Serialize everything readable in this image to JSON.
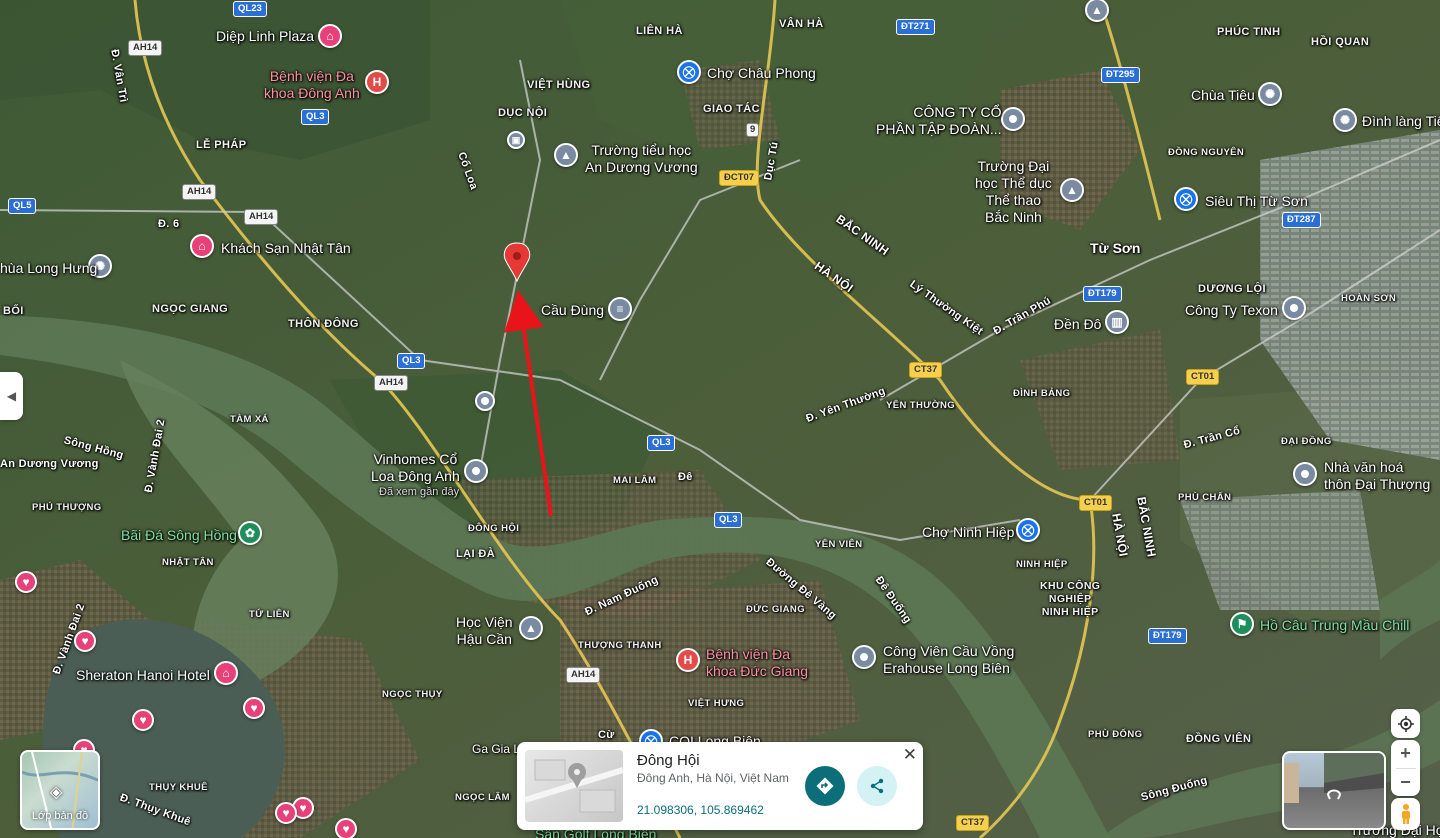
{
  "map": {
    "area_labels": [
      {
        "id": "van-ha",
        "text": "VÂN HÀ"
      },
      {
        "id": "lien-ha",
        "text": "LIÊN HÀ"
      },
      {
        "id": "phuc-tinh",
        "text": "PHÚC TINH"
      },
      {
        "id": "hoi-quan",
        "text": "HỒI QUAN"
      },
      {
        "id": "viet-hung",
        "text": "VIỆT HÙNG"
      },
      {
        "id": "duc-noi",
        "text": "DỤC NỘI"
      },
      {
        "id": "giao-tac",
        "text": "GIAO TÁC"
      },
      {
        "id": "le-phap",
        "text": "LỄ PHÁP"
      },
      {
        "id": "dong-nguyen",
        "text": "ĐỒNG NGUYÊN"
      },
      {
        "id": "ngoc-giang",
        "text": "NGỌC GIANG"
      },
      {
        "id": "thon-dong",
        "text": "THÔN ĐÔNG"
      },
      {
        "id": "duong-loi",
        "text": "DƯƠNG LỘI"
      },
      {
        "id": "hoan-son",
        "text": "HOÀN SƠN"
      },
      {
        "id": "tam-xa",
        "text": "TÀM XÁ"
      },
      {
        "id": "dinh-bang",
        "text": "ĐÌNH BẢNG"
      },
      {
        "id": "yen-thuong",
        "text": "YÊN THƯỜNG"
      },
      {
        "id": "dai-dong",
        "text": "ĐẠI ĐỒNG"
      },
      {
        "id": "mai-lam",
        "text": "MAI LÂM"
      },
      {
        "id": "phu-chan",
        "text": "PHÙ CHẨN"
      },
      {
        "id": "phu-thuong",
        "text": "PHÚ THƯỢNG"
      },
      {
        "id": "dong-hoi",
        "text": "ĐÔNG HỘI"
      },
      {
        "id": "lai-da",
        "text": "LẠI ĐÀ"
      },
      {
        "id": "yen-vien",
        "text": "YÊN VIÊN"
      },
      {
        "id": "ninh-hiep",
        "text": "NINH HIỆP"
      },
      {
        "id": "nhat-tan",
        "text": "NHẬT TÂN"
      },
      {
        "id": "tu-lien",
        "text": "TỨ LIÊN"
      },
      {
        "id": "duc-giang",
        "text": "ĐỨC GIANG"
      },
      {
        "id": "thuong-thanh",
        "text": "THƯỢNG THANH"
      },
      {
        "id": "ngoc-thuy",
        "text": "NGỌC THỤY"
      },
      {
        "id": "viet-hung-2",
        "text": "VIỆT HƯNG"
      },
      {
        "id": "phu-dong",
        "text": "PHÙ ĐỔNG"
      },
      {
        "id": "dong-vien",
        "text": "ĐỒNG VIÊN"
      },
      {
        "id": "ngoc-lam",
        "text": "NGỌC LÂM"
      },
      {
        "id": "thuy-khue",
        "text": "THỤY KHUÊ"
      },
      {
        "id": "tu-son",
        "text": "Từ Sơn"
      },
      {
        "id": "khu-cong-nghiep",
        "text": "KHU CÔNG\nNGHIỆP\nNINH HIỆP"
      },
      {
        "id": "bai-text",
        "text": "BỐI"
      }
    ],
    "road_names": [
      {
        "id": "d-van-tri",
        "text": "Đ. Vân Trì"
      },
      {
        "id": "co-loa",
        "text": "Cổ Loa"
      },
      {
        "id": "duc-tu",
        "text": "Dục Tú"
      },
      {
        "id": "d-6",
        "text": "Đ. 6"
      },
      {
        "id": "bac-ninh-diag",
        "text": "BẮC NINH"
      },
      {
        "id": "ha-noi-diag",
        "text": "HÀ NỘI"
      },
      {
        "id": "ly-thuong-kiet",
        "text": "Lý Thường Kiệt"
      },
      {
        "id": "d-tran-phu",
        "text": "Đ. Trần Phú"
      },
      {
        "id": "d-yen-thuong",
        "text": "Đ. Yên Thường"
      },
      {
        "id": "d-tran-co",
        "text": "Đ. Trần Cổ"
      },
      {
        "id": "d-nam-duong",
        "text": "Đ. Nam Đuống"
      },
      {
        "id": "duong-de-vang",
        "text": "Đường Đê Vàng"
      },
      {
        "id": "de-duong",
        "text": "Đê Đuống"
      },
      {
        "id": "d-vanh-dai-2",
        "text": "Đ. Vành Đai 2"
      },
      {
        "id": "song-hong",
        "text": "Sông Hồng"
      },
      {
        "id": "song-duong",
        "text": "Sông Đuống"
      },
      {
        "id": "an-duong-vuong",
        "text": "An Dương Vương"
      },
      {
        "id": "d-thuy-khue",
        "text": "Đ. Thụy Khuê"
      },
      {
        "id": "de-text",
        "text": "Đê"
      },
      {
        "id": "ha-noi-vert",
        "text": "HÀ NỘI"
      },
      {
        "id": "bac-ninh-vert",
        "text": "BẮC NINH"
      },
      {
        "id": "d-vanh-dai-2b",
        "text": "Đ. Vành Đai 2"
      },
      {
        "id": "cu-text",
        "text": "Cừ"
      },
      {
        "id": "ga-gia-lam",
        "text": "Ga Gia Lâ"
      }
    ],
    "shields": [
      {
        "id": "ql23",
        "text": "QL23",
        "style": "blue"
      },
      {
        "id": "ah14-a",
        "text": "AH14",
        "style": "white"
      },
      {
        "id": "ql3-a",
        "text": "QL3",
        "style": "blue"
      },
      {
        "id": "ah14-b",
        "text": "AH14",
        "style": "white"
      },
      {
        "id": "ql5",
        "text": "QL5",
        "style": "blue"
      },
      {
        "id": "ah14-c",
        "text": "AH14",
        "style": "white"
      },
      {
        "id": "dt271",
        "text": "ĐT271",
        "style": "blue"
      },
      {
        "id": "dct07",
        "text": "ĐCT07",
        "style": "yellow"
      },
      {
        "id": "dt295",
        "text": "ĐT295",
        "style": "blue"
      },
      {
        "id": "dt287",
        "text": "ĐT287",
        "style": "blue"
      },
      {
        "id": "dt179-a",
        "text": "ĐT179",
        "style": "blue"
      },
      {
        "id": "ct37-a",
        "text": "CT37",
        "style": "yellow"
      },
      {
        "id": "ct01-a",
        "text": "CT01",
        "style": "yellow"
      },
      {
        "id": "ql3-b",
        "text": "QL3",
        "style": "blue"
      },
      {
        "id": "ah14-d",
        "text": "AH14",
        "style": "white"
      },
      {
        "id": "ql3-c",
        "text": "QL3",
        "style": "blue"
      },
      {
        "id": "ql3-d",
        "text": "QL3",
        "style": "blue"
      },
      {
        "id": "ct01-b",
        "text": "CT01",
        "style": "yellow"
      },
      {
        "id": "dt179-b",
        "text": "ĐT179",
        "style": "blue"
      },
      {
        "id": "ah14-e",
        "text": "AH14",
        "style": "white"
      },
      {
        "id": "ct37-b",
        "text": "CT37",
        "style": "yellow"
      },
      {
        "id": "nine",
        "text": "9",
        "style": "white"
      }
    ],
    "pois": [
      {
        "id": "diep-linh",
        "text": "Diệp Linh Plaza",
        "icon": "hotel-icon",
        "pin": "pink",
        "color": "white"
      },
      {
        "id": "bv-dong-anh",
        "text": "Bệnh viện Đa\nkhoa Đông Anh",
        "icon": "hospital-icon",
        "pin": "red",
        "color": "pink"
      },
      {
        "id": "cho-chau-phong",
        "text": "Chợ Châu Phong",
        "icon": "shopping-icon",
        "pin": "blue",
        "color": "white"
      },
      {
        "id": "cong-ty-co",
        "text": "CÔNG TY CỔ\nPHẦN TẬP ĐOÀN...",
        "icon": "place-icon",
        "pin": "gray",
        "color": "white"
      },
      {
        "id": "chua-tieu",
        "text": "Chùa Tiêu",
        "icon": "temple-icon",
        "pin": "gray",
        "color": "white"
      },
      {
        "id": "dinh-lang-tieu",
        "text": "Đình làng Tiê",
        "icon": "temple-icon",
        "pin": "gray",
        "color": "white"
      },
      {
        "id": "truong-tieu-hoc",
        "text": "Trường tiểu học\nAn Dương Vương",
        "icon": "school-icon",
        "pin": "gray",
        "color": "white"
      },
      {
        "id": "truong-dai-hoc",
        "text": "Trường Đại\nhọc Thể dục\nThể thao\nBắc Ninh",
        "icon": "school-icon",
        "pin": "gray",
        "color": "white"
      },
      {
        "id": "sieu-thi-tu-son",
        "text": "Siêu Thị Từ Sơn",
        "icon": "shopping-icon",
        "pin": "blue",
        "color": "white"
      },
      {
        "id": "ks-nhat-tan",
        "text": "Khách Sạn Nhật Tân",
        "icon": "hotel-icon",
        "pin": "pink",
        "color": "white"
      },
      {
        "id": "chua-long-hung",
        "text": "hùa Long Hưng",
        "icon": "temple-icon",
        "pin": "gray",
        "color": "white"
      },
      {
        "id": "cau-dung",
        "text": "Cầu Đùng",
        "icon": "bridge-icon",
        "pin": "gray",
        "color": "white"
      },
      {
        "id": "den-do",
        "text": "Đền Đô",
        "icon": "museum-icon",
        "pin": "gray",
        "color": "white"
      },
      {
        "id": "cong-ty-texon",
        "text": "Công Ty Texon",
        "icon": "place-icon",
        "pin": "gray",
        "color": "white"
      },
      {
        "id": "vinhomes",
        "text": "Vinhomes Cổ\nLoa Đông Anh",
        "icon": "place-icon",
        "pin": "gray",
        "color": "white"
      },
      {
        "id": "nha-van-hoa",
        "text": "Nhà văn hoá\nthôn Đại Thượng",
        "icon": "place-icon",
        "pin": "gray",
        "color": "white"
      },
      {
        "id": "bai-da",
        "text": "Bãi Đá Sông Hồng",
        "icon": "park-icon",
        "pin": "green",
        "color": "green"
      },
      {
        "id": "cho-ninh-hiep",
        "text": "Chợ Ninh Hiệp",
        "icon": "shopping-icon",
        "pin": "blue",
        "color": "white"
      },
      {
        "id": "hv-hau-can",
        "text": "Học Viện\nHậu Cần",
        "icon": "school-icon",
        "pin": "gray",
        "color": "white"
      },
      {
        "id": "bv-duc-giang",
        "text": "Bệnh viện Đa\nkhoa Đức Giang",
        "icon": "hospital-icon",
        "pin": "red",
        "color": "pink"
      },
      {
        "id": "cong-vien",
        "text": "Công Viên Cầu Vồng\nErahouse Long Biên",
        "icon": "place-icon",
        "pin": "gray",
        "color": "white"
      },
      {
        "id": "ho-cau",
        "text": "Hồ Câu Trung Mầu Chill",
        "icon": "fishing-icon",
        "pin": "green",
        "color": "green"
      },
      {
        "id": "sheraton",
        "text": "Sheraton Hanoi Hotel",
        "icon": "hotel-icon",
        "pin": "pink",
        "color": "white"
      },
      {
        "id": "coi-long-bien",
        "text": "COI Long Biên",
        "icon": "shopping-icon",
        "pin": "blue",
        "color": "white"
      },
      {
        "id": "truong-dai-hoc-co",
        "text": "Trường Đại Học Cô",
        "icon": "school-icon",
        "pin": "gray",
        "color": "white"
      },
      {
        "id": "son-golf",
        "text": "Sân Golf Long Biên",
        "icon": "golf-icon",
        "pin": "green",
        "color": "green"
      }
    ],
    "visited_note": "Đã xem gần đây",
    "marker_label": "Đông Hội"
  },
  "card": {
    "title": "Đông Hội",
    "address": "Đông Anh, Hà Nội, Việt Nam",
    "coords": "21.098306, 105.869462",
    "directions_icon": "directions-icon",
    "share_icon": "share-icon",
    "close_icon": "close-icon"
  },
  "layers": {
    "label": "Lớp bản đồ",
    "icon": "layers-icon"
  },
  "controls": {
    "zoom_in": "+",
    "zoom_out": "−",
    "locate_icon": "my-location-icon",
    "pegman_icon": "pegman-icon"
  },
  "colors": {
    "accent": "#0b6e79",
    "marker": "#e53935",
    "arrow": "#e8141a",
    "river": "#5b7a52"
  }
}
